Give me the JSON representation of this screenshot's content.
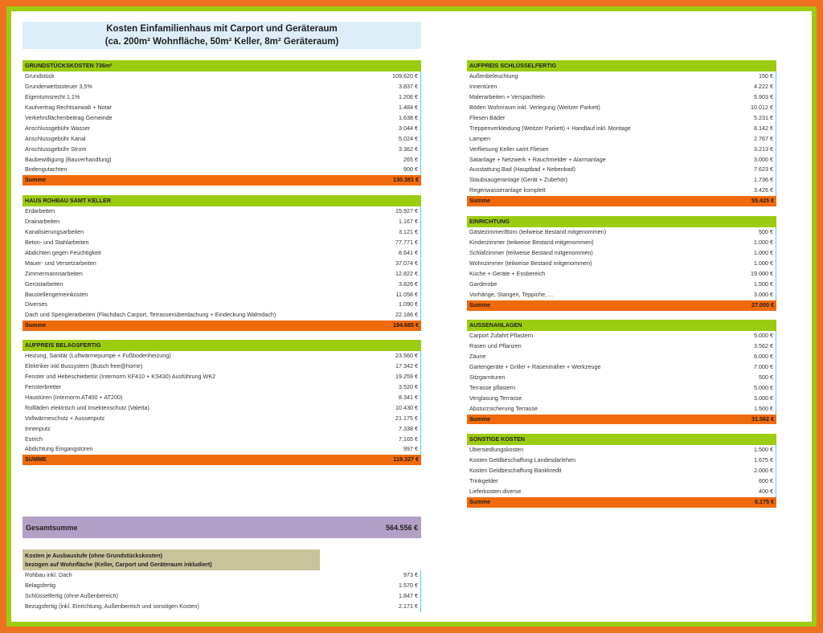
{
  "title": {
    "line1": "Kosten Einfamilienhaus mit Carport und Geräteraum",
    "line2": "(ca. 200m² Wohnfläche, 50m² Keller, 8m² Geräteraum)"
  },
  "left_sections": [
    {
      "header": "GRUNDSTÜCKSKOSTEN 736m²",
      "rows": [
        {
          "label": "Grundstück",
          "amount": "109.620 €"
        },
        {
          "label": "Grunderwerbssteuer 3,5%",
          "amount": "3.837 €"
        },
        {
          "label": "Eigentumsrecht 1,1%",
          "amount": "1.206 €"
        },
        {
          "label": "Kaufvertrag Rechtsanwalt + Notar",
          "amount": "1.484 €"
        },
        {
          "label": "Verkehrsflächenbeitrag Gemeinde",
          "amount": "1.638 €"
        },
        {
          "label": "Anschlussgebühr Wasser",
          "amount": "3.044 €"
        },
        {
          "label": "Anschlussgebühr Kanal",
          "amount": "5.024 €"
        },
        {
          "label": "Anschlussgebühr Strom",
          "amount": "3.362 €"
        },
        {
          "label": "Baubewilligung (Bauverhandlung)",
          "amount": "265 €"
        },
        {
          "label": "Bodengutachten",
          "amount": "900 €"
        }
      ],
      "total_label": "Summe",
      "total": "130.381 €"
    },
    {
      "header": "HAUS ROHBAU SAMT KELLER",
      "rows": [
        {
          "label": "Erdarbeiten",
          "amount": "15.927 €"
        },
        {
          "label": "Drainarbeiten",
          "amount": "1.167 €"
        },
        {
          "label": "Kanalisierungsarbeiten",
          "amount": "3.121 €"
        },
        {
          "label": "Beton- und Stahlarbeiten",
          "amount": "77.771 €"
        },
        {
          "label": "Abdichten gegen Feuchtigkeit",
          "amount": "8.641 €"
        },
        {
          "label": "Mauer- und Versetzarbeiten",
          "amount": "37.074 €"
        },
        {
          "label": "Zimmermannsarbeiten",
          "amount": "12.822 €"
        },
        {
          "label": "Gerüstarbeiten",
          "amount": "3.826 €"
        },
        {
          "label": "Baustellengemeinkosten",
          "amount": "11.058 €"
        },
        {
          "label": "Diverses",
          "amount": "1.090 €"
        },
        {
          "label": "Dach und Spenglerarbeiten (Flachdach Carport, Terrassenüberdachung + Eindeckung Walmdach)",
          "amount": "22.186 €"
        }
      ],
      "total_label": "Summe",
      "total": "194.685 €"
    },
    {
      "header": "AUFPREIS BELAGSFERTIG",
      "rows": [
        {
          "label": "Heizung, Sanitär (Luftwärmepumpe + Fußbodenheizung)",
          "amount": "23.560 €"
        },
        {
          "label": "Elektriker inkl Bussystem (Busch free@home)",
          "amount": "17.342 €"
        },
        {
          "label": "Fenster und Hebeschiebetür (Internorm KF410 + KS430) Ausführung WK2",
          "amount": "19.259 €"
        },
        {
          "label": "Fensterbretter",
          "amount": "3.520 €"
        },
        {
          "label": "Haustüren (Internorm AT400 + AT200)",
          "amount": "8.341 €"
        },
        {
          "label": "Rollläden elektrisch und Insektenschutz (Valetta)",
          "amount": "10.430 €"
        },
        {
          "label": "Vollwärmeschutz + Aussenputz",
          "amount": "21.175 €"
        },
        {
          "label": "Innenputz",
          "amount": "7.338 €"
        },
        {
          "label": "Estrich",
          "amount": "7.165 €"
        },
        {
          "label": "Abdichtung Eingangstüren",
          "amount": "997 €"
        }
      ],
      "total_label": "SUMME",
      "total": "119.327 €"
    }
  ],
  "right_sections": [
    {
      "header": "AUFPREIS SCHLÜSSELFERTIG",
      "rows": [
        {
          "label": "Außenbeleuchtung",
          "amount": "150 €"
        },
        {
          "label": "Innentüren",
          "amount": "4.222 €"
        },
        {
          "label": "Malerarbeiten + Verspachteln",
          "amount": "5.903 €"
        },
        {
          "label": "Böden Wohnraum inkl. Verlegung (Weitzer Parkett)",
          "amount": "10.012 €"
        },
        {
          "label": "Fliesen Bäder",
          "amount": "5.231 €"
        },
        {
          "label": "Treppenverkleidung (Weitzer Parkett) + Handlauf inkl. Montage",
          "amount": "8.142 €"
        },
        {
          "label": "Lampen",
          "amount": "2.767 €"
        },
        {
          "label": "Verfliesung Keller samt Fliesen",
          "amount": "3.213 €"
        },
        {
          "label": "Satanlage + Netzwerk + Rauchmelder + Alarmanlage",
          "amount": "3.000 €"
        },
        {
          "label": "Ausstattung Bad (Hauptbad + Nebenbad)",
          "amount": "7.623 €"
        },
        {
          "label": "Staubsaugeranlage (Gerät + Zubehör)",
          "amount": "1.736 €"
        },
        {
          "label": "Regenwasseranlage komplett",
          "amount": "3.426 €"
        }
      ],
      "total_label": "Summe",
      "total": "55.425 €"
    },
    {
      "header": "EINRICHTUNG",
      "rows": [
        {
          "label": "Gästezimmer/Büro (teilweise Bestand mitgenommen)",
          "amount": "500 €"
        },
        {
          "label": "Kinderzimmer (teilweise Bestand mitgenommen)",
          "amount": "1.000 €"
        },
        {
          "label": "Schlafzimmer (teilweise Bestand mitgenommen)",
          "amount": "1.000 €"
        },
        {
          "label": "Wohnzimmer (teilweise Bestand mitgenommen)",
          "amount": "1.000 €"
        },
        {
          "label": "Küche + Geräte + Essbereich",
          "amount": "19.000 €"
        },
        {
          "label": "Garderobe",
          "amount": "1.500 €"
        },
        {
          "label": "Vorhänge, Stangen, Teppiche, ...",
          "amount": "3.000 €"
        }
      ],
      "total_label": "Summe",
      "total": "27.000 €"
    },
    {
      "header": "AUSSENANLAGEN",
      "rows": [
        {
          "label": "Carport Zufahrt Pflastern",
          "amount": "5.000 €"
        },
        {
          "label": "Rasen und Pflanzen",
          "amount": "3.562 €"
        },
        {
          "label": "Zäune",
          "amount": "6.000 €"
        },
        {
          "label": "Gartengeräte + Griller + Rasenmäher + Werkzeuge",
          "amount": "7.000 €"
        },
        {
          "label": "Sitzgarnituren",
          "amount": "500 €"
        },
        {
          "label": "Terrasse pflastern",
          "amount": "5.000 €"
        },
        {
          "label": "Verglasung Terrasse",
          "amount": "3.000 €"
        },
        {
          "label": "Absturzsicherung Terrasse",
          "amount": "1.500 €"
        }
      ],
      "total_label": "Summe",
      "total": "31.562 €"
    },
    {
      "header": "SONSTIGE KOSTEN",
      "rows": [
        {
          "label": "Übersiedlungskosten",
          "amount": "1.500 €"
        },
        {
          "label": "Kosten Geldbeschaffung Landesdarlehen",
          "amount": "1.675 €"
        },
        {
          "label": "Kosten Geldbeschaffung Bankkredit",
          "amount": "2.000 €"
        },
        {
          "label": "Trinkgelder",
          "amount": "600 €"
        },
        {
          "label": "Lieferkosten diverse",
          "amount": "400 €"
        }
      ],
      "total_label": "Summe",
      "total": "6.175 €"
    }
  ],
  "gesamt": {
    "label": "Gesamtsumme",
    "amount": "564.556 €"
  },
  "per_m2": {
    "header_line1": "Kosten je Ausbaustufe (ohne Grundstückskosten)",
    "header_line2": "bezogen auf Wohnfläche (Keller, Carport und Geräteraum inkludiert)",
    "rows": [
      {
        "label": "Rohbau inkl. Dach",
        "amount": "973 €"
      },
      {
        "label": "Belagsfertig",
        "amount": "1.570 €"
      },
      {
        "label": "Schlüsselfertig (ohne Außenbereich)",
        "amount": "1.847 €"
      },
      {
        "label": "Bezugsfertig (inkl. Einrichtung, Außenbereich und sonstigen Kosten)",
        "amount": "2.171 €"
      }
    ]
  },
  "colors": {
    "orange": "#ef6a0c",
    "green": "#9ccc12",
    "lightblue": "#ddeef8",
    "purple": "#b3a0c6",
    "khaki": "#c8c39a"
  }
}
